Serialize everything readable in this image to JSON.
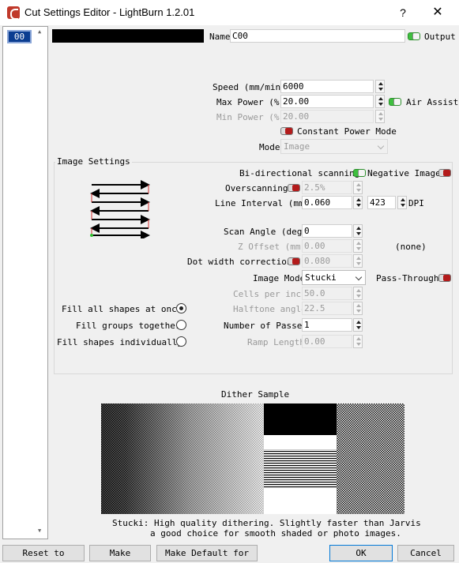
{
  "window": {
    "title": "Cut Settings Editor - LightBurn 1.2.01",
    "help": "?",
    "close": "✕"
  },
  "layers": {
    "items": [
      {
        "label": "00",
        "color": "#0b3d91"
      }
    ]
  },
  "layer_color": "#000000",
  "name": {
    "label": "Name",
    "value": "C00"
  },
  "output": {
    "label": "Output",
    "on": true
  },
  "speed": {
    "label": "Speed (mm/min)",
    "value": "6000"
  },
  "max_power": {
    "label": "Max Power (%)",
    "value": "20.00"
  },
  "air_assist": {
    "label": "Air Assist",
    "on": true
  },
  "min_power": {
    "label": "Min Power (%)",
    "value": "20.00"
  },
  "constant_power": {
    "label": "Constant Power Mode",
    "on": false
  },
  "mode": {
    "label": "Mode",
    "value": "Image"
  },
  "image_settings": {
    "title": "Image Settings",
    "bidirectional": {
      "label": "Bi-directional scanning",
      "on": true
    },
    "negative_image": {
      "label": "Negative Image",
      "on": false
    },
    "overscanning": {
      "label": "Overscanning",
      "on": false,
      "value": "2.5%"
    },
    "line_interval": {
      "label": "Line Interval (mm)",
      "value": "0.060",
      "dpi_value": "423",
      "dpi_label": "DPI"
    },
    "scan_angle": {
      "label": "Scan Angle (deg)",
      "value": "0"
    },
    "z_offset": {
      "label": "Z Offset (mm)",
      "value": "0.00",
      "note": "(none)"
    },
    "dot_width": {
      "label": "Dot width correction",
      "on": false,
      "value": "0.080"
    },
    "image_mode": {
      "label": "Image Mode",
      "value": "Stucki"
    },
    "pass_through": {
      "label": "Pass-Through",
      "on": false
    },
    "cells_per_inch": {
      "label": "Cells per inch",
      "value": "50.0"
    },
    "halftone_angle": {
      "label": "Halftone angle",
      "value": "22.5"
    },
    "number_of_passes": {
      "label": "Number of Passes",
      "value": "1"
    },
    "ramp_length": {
      "label": "Ramp Length",
      "value": "0.00"
    },
    "fill_options": [
      {
        "label": "Fill all shapes at once",
        "checked": true
      },
      {
        "label": "Fill groups together",
        "checked": false
      },
      {
        "label": "Fill shapes individually",
        "checked": false
      }
    ]
  },
  "dither": {
    "title": "Dither Sample",
    "description_line1": "Stucki: High quality dithering. Slightly faster than Jarvis",
    "description_line2": "a good choice for smooth shaded or photo images."
  },
  "buttons": {
    "reset": "Reset to Default",
    "make_default": "Make Default",
    "make_default_all": "Make Default for All",
    "ok": "OK",
    "cancel": "Cancel"
  }
}
